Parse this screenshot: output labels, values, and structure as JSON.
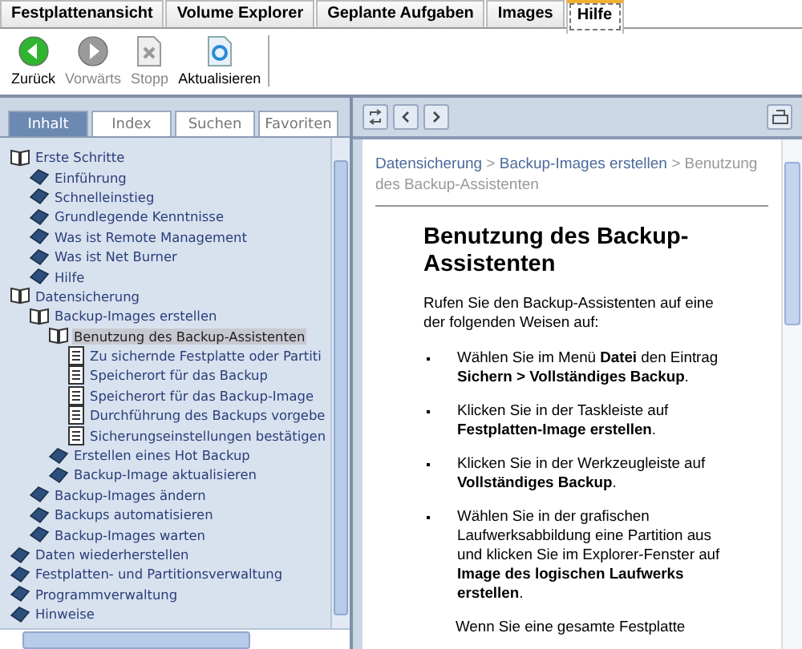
{
  "top_tabs": [
    {
      "label": "Festplattenansicht",
      "selected": false
    },
    {
      "label": "Volume Explorer",
      "selected": false
    },
    {
      "label": "Geplante Aufgaben",
      "selected": false
    },
    {
      "label": "Images",
      "selected": false
    },
    {
      "label": "Hilfe",
      "selected": true
    }
  ],
  "toolbar": [
    {
      "label": "Zurück",
      "kind": "back",
      "disabled": false
    },
    {
      "label": "Vorwärts",
      "kind": "forward",
      "disabled": true
    },
    {
      "label": "Stopp",
      "kind": "stop",
      "disabled": true
    },
    {
      "label": "Aktualisieren",
      "kind": "refresh",
      "disabled": false
    }
  ],
  "nav_tabs": [
    {
      "label": "Inhalt",
      "selected": true
    },
    {
      "label": "Index",
      "selected": false
    },
    {
      "label": "Suchen",
      "selected": false
    },
    {
      "label": "Favoriten",
      "selected": false
    }
  ],
  "tree": [
    {
      "label": "Erste Schritte",
      "kind": "book",
      "expanded": true,
      "selected": false,
      "children": [
        {
          "label": "Einführung",
          "kind": "book",
          "expanded": false,
          "selected": false
        },
        {
          "label": "Schnelleinstieg",
          "kind": "book",
          "expanded": false,
          "selected": false
        },
        {
          "label": "Grundlegende Kenntnisse",
          "kind": "book",
          "expanded": false,
          "selected": false
        },
        {
          "label": "Was ist Remote Management",
          "kind": "book",
          "expanded": false,
          "selected": false
        },
        {
          "label": "Was ist Net Burner",
          "kind": "book",
          "expanded": false,
          "selected": false
        },
        {
          "label": "Hilfe",
          "kind": "book",
          "expanded": false,
          "selected": false
        }
      ]
    },
    {
      "label": "Datensicherung",
      "kind": "book",
      "expanded": true,
      "selected": false,
      "children": [
        {
          "label": "Backup-Images erstellen",
          "kind": "book",
          "expanded": true,
          "selected": false,
          "children": [
            {
              "label": "Benutzung des Backup-Assistenten",
              "kind": "book",
              "expanded": true,
              "selected": true,
              "children": [
                {
                  "label": "Zu sichernde Festplatte oder Partiti",
                  "kind": "page",
                  "selected": false
                },
                {
                  "label": "Speicherort für das Backup",
                  "kind": "page",
                  "selected": false
                },
                {
                  "label": "Speicherort für das Backup-Image",
                  "kind": "page",
                  "selected": false
                },
                {
                  "label": "Durchführung des Backups vorgebe",
                  "kind": "page",
                  "selected": false
                },
                {
                  "label": "Sicherungseinstellungen bestätigen",
                  "kind": "page",
                  "selected": false
                }
              ]
            },
            {
              "label": "Erstellen eines Hot Backup",
              "kind": "book",
              "expanded": false,
              "selected": false
            },
            {
              "label": "Backup-Image aktualisieren",
              "kind": "book",
              "expanded": false,
              "selected": false
            }
          ]
        },
        {
          "label": "Backup-Images ändern",
          "kind": "book",
          "expanded": false,
          "selected": false
        },
        {
          "label": "Backups automatisieren",
          "kind": "book",
          "expanded": false,
          "selected": false
        },
        {
          "label": "Backup-Images warten",
          "kind": "book",
          "expanded": false,
          "selected": false
        }
      ]
    },
    {
      "label": "Daten wiederherstellen",
      "kind": "book",
      "expanded": false,
      "selected": false
    },
    {
      "label": "Festplatten- und Partitionsverwaltung",
      "kind": "book",
      "expanded": false,
      "selected": false
    },
    {
      "label": "Programmverwaltung",
      "kind": "book",
      "expanded": false,
      "selected": false
    },
    {
      "label": "Hinweise",
      "kind": "book",
      "expanded": false,
      "selected": false
    }
  ],
  "content_toolbar": [
    {
      "kind": "sync"
    },
    {
      "kind": "prev"
    },
    {
      "kind": "next"
    }
  ],
  "breadcrumb": {
    "separator": ">",
    "items": [
      {
        "label": "Datensicherung",
        "link": true
      },
      {
        "label": "Backup-Images erstellen",
        "link": true
      },
      {
        "label": "Benutzung des Backup-Assistenten",
        "link": false
      }
    ]
  },
  "heading": "Benutzung des Backup-Assistenten",
  "intro": "Rufen Sie den Backup-Assistenten auf eine der folgenden Weisen auf:",
  "bullets": [
    "Wählen Sie im Menü **Datei** den Eintrag **Sichern > Vollständiges Backup**.",
    "Klicken Sie in der Taskleiste auf **Festplatten-Image erstellen**.",
    "Klicken Sie in der Werkzeugleiste auf **Vollständiges Backup**.",
    "Wählen Sie in der grafischen Laufwerksabbildung eine Partition aus und klicken Sie im Explorer-Fenster auf **Image des logischen Laufwerks erstellen**."
  ],
  "trailing": "Wenn Sie eine gesamte Festplatte"
}
